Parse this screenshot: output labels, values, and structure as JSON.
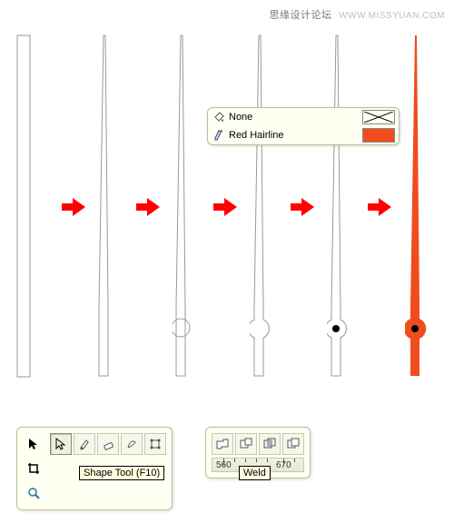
{
  "watermark": {
    "cn": "思缘设计论坛",
    "url": "WWW.MISSYUAN.COM"
  },
  "popup": {
    "row1_label": "None",
    "row2_label": "Red Hairline"
  },
  "panel_shape": {
    "tooltip": "Shape Tool (F10)"
  },
  "panel_weld": {
    "tooltip": "Weld",
    "ruler_v1": "560",
    "ruler_v2": "670"
  }
}
